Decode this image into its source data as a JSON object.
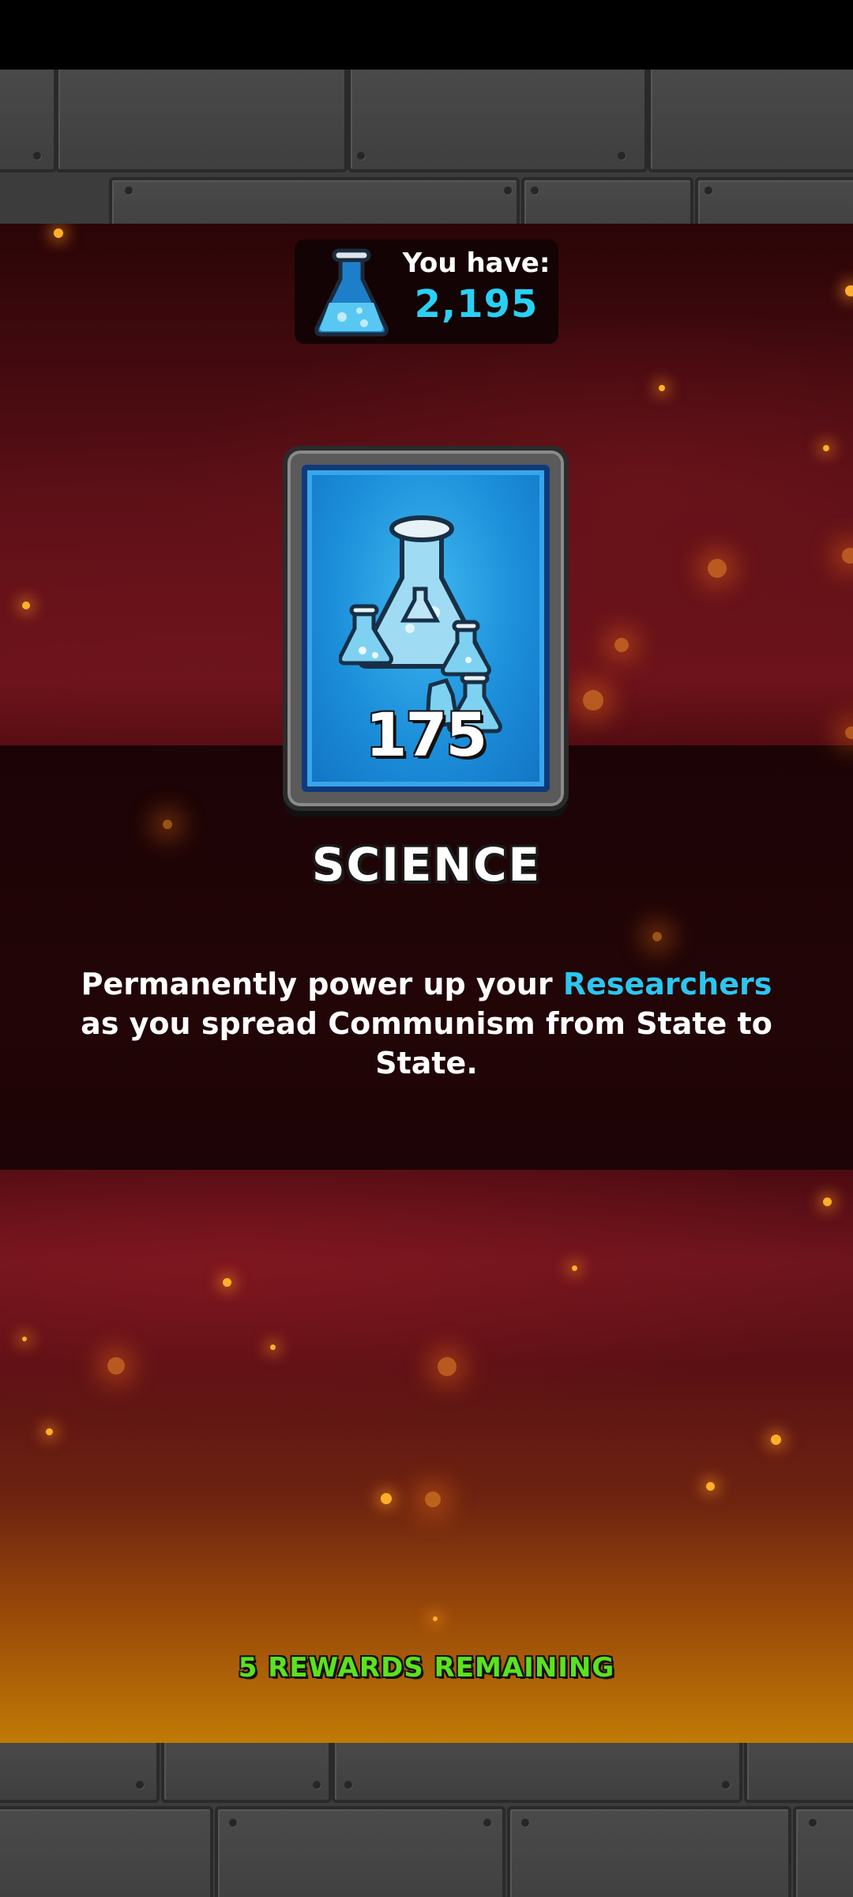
{
  "currency": {
    "label": "You have:",
    "value": "2,195",
    "icon": "flask-icon"
  },
  "reward_card": {
    "count": "175",
    "icon": "flasks-bundle-icon",
    "colors": {
      "card_blue": "#1c8fda",
      "frame_gray": "#5a5a5a"
    }
  },
  "reward": {
    "title": "SCIENCE",
    "description_prefix": "Permanently power up your ",
    "description_highlight": "Researchers",
    "description_suffix": " as you spread Communism from State to State."
  },
  "footer": {
    "remaining": "5 REWARDS REMAINING"
  },
  "colors": {
    "accent": "#2ad0f4",
    "remaining_green": "#5be21f",
    "background_red": "#6d131b"
  }
}
